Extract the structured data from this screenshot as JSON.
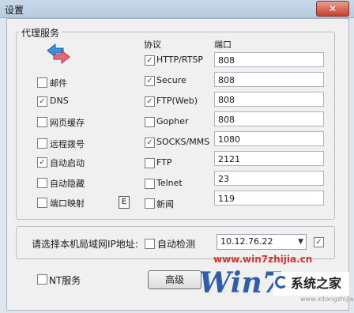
{
  "window": {
    "title": "设置",
    "background_title": "",
    "close_glyph": "✕"
  },
  "proxy_group": {
    "title": "代理服务",
    "services": [
      {
        "label": "邮件",
        "checked": false
      },
      {
        "label": "DNS",
        "checked": true
      },
      {
        "label": "网页缓存",
        "checked": false
      },
      {
        "label": "远程拨号",
        "checked": false
      },
      {
        "label": "自动启动",
        "checked": true
      },
      {
        "label": "自动隐藏",
        "checked": false
      },
      {
        "label": "端口映射",
        "checked": false
      }
    ],
    "port_map_button": "E"
  },
  "protocols": {
    "header_protocol": "协议",
    "header_port": "端口",
    "rows": [
      {
        "label": "HTTP/RTSP",
        "checked": true,
        "port": "808"
      },
      {
        "label": "Secure",
        "checked": true,
        "port": "808"
      },
      {
        "label": "FTP(Web)",
        "checked": true,
        "port": "808"
      },
      {
        "label": "Gopher",
        "checked": false,
        "port": "808"
      },
      {
        "label": "SOCKS/MMS",
        "checked": true,
        "port": "1080"
      },
      {
        "label": "FTP",
        "checked": false,
        "port": "2121"
      },
      {
        "label": "Telnet",
        "checked": false,
        "port": "23"
      },
      {
        "label": "新闻",
        "checked": false,
        "port": "119"
      }
    ]
  },
  "lan_ip": {
    "label": "请选择本机局域网IP地址:",
    "auto_detect_label": "自动检测",
    "auto_detect_checked": false,
    "selected_ip": "10.12.76.22",
    "extra_checked": true
  },
  "footer": {
    "nt_service_label": "NT服务",
    "nt_service_checked": false,
    "advanced_button": "高级"
  },
  "watermark": {
    "site": "www.win7zhijia.cn",
    "brand": "系统之家",
    "sub": "www.xitongzhijia.net"
  },
  "colors": {
    "check_mark": "#2a4f9c",
    "title_gradient": "#c9d9ea",
    "watermark_blue": "#2f5ea8",
    "watermark_red": "#e03030"
  }
}
